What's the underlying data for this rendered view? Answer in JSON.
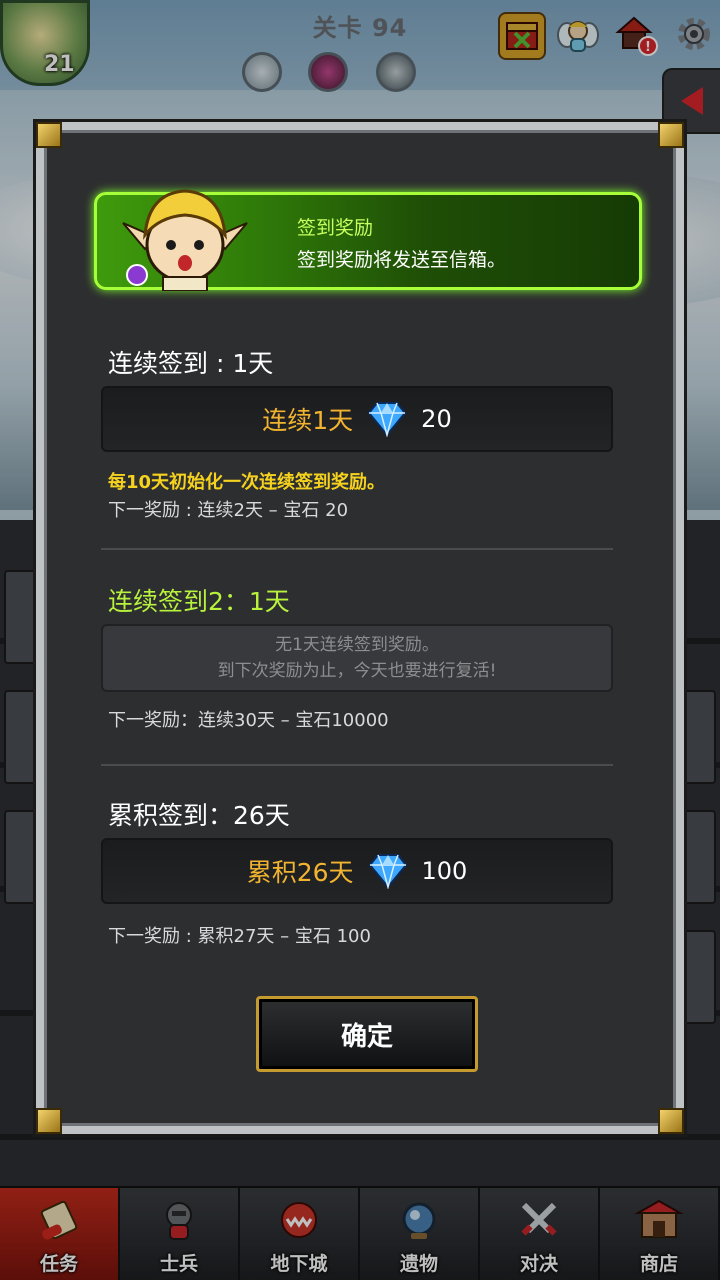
{
  "hud": {
    "player_level": "21",
    "stage_title": "关卡 94"
  },
  "dialog": {
    "banner": {
      "title": "签到奖励",
      "description": "签到奖励将发送至信箱。"
    },
    "consecutive": {
      "title": "连续签到 : 1天",
      "reward_label": "连续1天",
      "reward_value": "20",
      "reset_note": "每10天初始化一次连续签到奖励。",
      "next_reward": "下一奖励 : 连续2天 – 宝石 20"
    },
    "consecutive2": {
      "title": "连续签到2：1天",
      "empty_line1": "无1天连续签到奖励。",
      "empty_line2": "到下次奖励为止，今天也要进行复活!",
      "next_reward": "下一奖励：连续30天 – 宝石10000"
    },
    "cumulative": {
      "title": "累积签到：26天",
      "reward_label": "累积26天",
      "reward_value": "100",
      "next_reward": "下一奖励 : 累积27天 – 宝石 100"
    },
    "confirm_label": "确定"
  },
  "bottom_nav": [
    {
      "label": "任务",
      "icon": "scroll-icon"
    },
    {
      "label": "士兵",
      "icon": "soldier-icon"
    },
    {
      "label": "地下城",
      "icon": "dungeon-icon"
    },
    {
      "label": "遗物",
      "icon": "relic-icon"
    },
    {
      "label": "对决",
      "icon": "swords-icon"
    },
    {
      "label": "商店",
      "icon": "shop-icon"
    }
  ],
  "colors": {
    "accent_gold": "#f2b430",
    "accent_green": "#b8f23c",
    "note_yellow": "#f5d21e",
    "nav_active": "#c22b1d"
  }
}
